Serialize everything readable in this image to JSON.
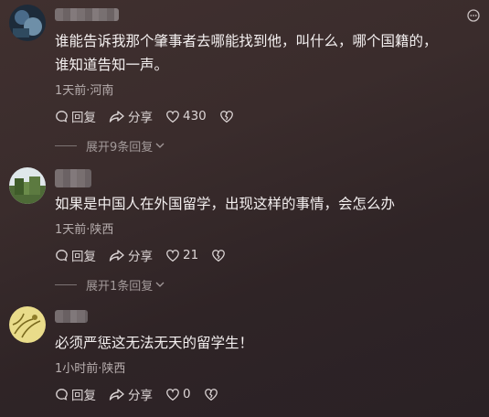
{
  "comments": [
    {
      "text": "谁能告诉我那个肇事者去哪能找到他，叫什么，哪个国籍的，\n谁知道告知一声。",
      "meta": "1天前·河南",
      "reply_label": "回复",
      "share_label": "分享",
      "likes": "430",
      "expand_label": "展开9条回复"
    },
    {
      "text": "如果是中国人在外国留学，出现这样的事情，会怎么办",
      "meta": "1天前·陕西",
      "reply_label": "回复",
      "share_label": "分享",
      "likes": "21",
      "expand_label": "展开1条回复"
    },
    {
      "text": "必须严惩这无法无天的留学生！",
      "meta": "1小时前·陕西",
      "reply_label": "回复",
      "share_label": "分享",
      "likes": "0"
    }
  ],
  "icons": {
    "reply": "comment-bubble-icon",
    "share": "share-arrow-icon",
    "like": "heart-icon",
    "dislike": "broken-heart-icon",
    "more": "more-options-icon",
    "expand": "chevron-down-icon"
  },
  "colors": {
    "background": "#3a2c2c",
    "text": "#f4f0f0",
    "meta": "#b7aeae"
  }
}
